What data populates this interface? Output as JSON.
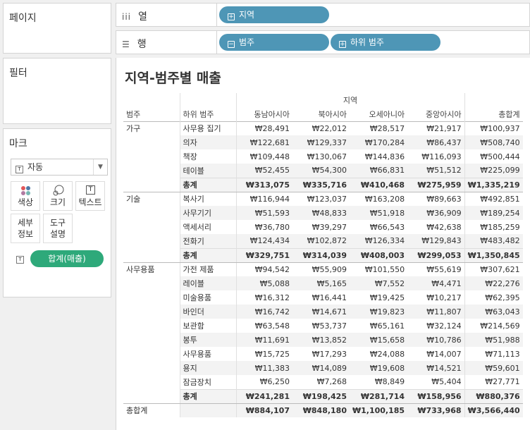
{
  "left": {
    "pages_title": "페이지",
    "filters_title": "필터",
    "marks_title": "마크",
    "mark_type": "자동",
    "mark_buttons": [
      "색상",
      "크기",
      "텍스트",
      "세부\n정보",
      "도구\n설명"
    ],
    "mark_pill": "합계(매출)"
  },
  "shelves": {
    "columns_label": "열",
    "rows_label": "행",
    "columns_pill": "지역",
    "rows_pills": [
      "범주",
      "하위 범주"
    ]
  },
  "view": {
    "title": "지역-범주별 매출",
    "header_group": "지역",
    "headers": [
      "범주",
      "하위 범주",
      "동남아시아",
      "북아시아",
      "오세아니아",
      "중앙아시아",
      "총합계"
    ],
    "groups": [
      {
        "category": "가구",
        "rows": [
          [
            "사무용 집기",
            "₩28,491",
            "₩22,012",
            "₩28,517",
            "₩21,917",
            "₩100,937"
          ],
          [
            "의자",
            "₩122,681",
            "₩129,337",
            "₩170,284",
            "₩86,437",
            "₩508,740"
          ],
          [
            "책장",
            "₩109,448",
            "₩130,067",
            "₩144,836",
            "₩116,093",
            "₩500,444"
          ],
          [
            "테이블",
            "₩52,455",
            "₩54,300",
            "₩66,831",
            "₩51,512",
            "₩225,099"
          ]
        ],
        "total": [
          "총계",
          "₩313,075",
          "₩335,716",
          "₩410,468",
          "₩275,959",
          "₩1,335,219"
        ]
      },
      {
        "category": "기술",
        "rows": [
          [
            "복사기",
            "₩116,944",
            "₩123,037",
            "₩163,208",
            "₩89,663",
            "₩492,851"
          ],
          [
            "사무기기",
            "₩51,593",
            "₩48,833",
            "₩51,918",
            "₩36,909",
            "₩189,254"
          ],
          [
            "액세서리",
            "₩36,780",
            "₩39,297",
            "₩66,543",
            "₩42,638",
            "₩185,259"
          ],
          [
            "전화기",
            "₩124,434",
            "₩102,872",
            "₩126,334",
            "₩129,843",
            "₩483,482"
          ]
        ],
        "total": [
          "총계",
          "₩329,751",
          "₩314,039",
          "₩408,003",
          "₩299,053",
          "₩1,350,845"
        ]
      },
      {
        "category": "사무용품",
        "rows": [
          [
            "가전 제품",
            "₩94,542",
            "₩55,909",
            "₩101,550",
            "₩55,619",
            "₩307,621"
          ],
          [
            "레이블",
            "₩5,088",
            "₩5,165",
            "₩7,552",
            "₩4,471",
            "₩22,276"
          ],
          [
            "미술용품",
            "₩16,312",
            "₩16,441",
            "₩19,425",
            "₩10,217",
            "₩62,395"
          ],
          [
            "바인더",
            "₩16,742",
            "₩14,671",
            "₩19,823",
            "₩11,807",
            "₩63,043"
          ],
          [
            "보관함",
            "₩63,548",
            "₩53,737",
            "₩65,161",
            "₩32,124",
            "₩214,569"
          ],
          [
            "봉투",
            "₩11,691",
            "₩13,852",
            "₩15,658",
            "₩10,786",
            "₩51,988"
          ],
          [
            "사무용품",
            "₩15,725",
            "₩17,293",
            "₩24,088",
            "₩14,007",
            "₩71,113"
          ],
          [
            "용지",
            "₩11,383",
            "₩14,089",
            "₩19,608",
            "₩14,521",
            "₩59,601"
          ],
          [
            "잠금장치",
            "₩6,250",
            "₩7,268",
            "₩8,849",
            "₩5,404",
            "₩27,771"
          ]
        ],
        "total": [
          "총계",
          "₩241,281",
          "₩198,425",
          "₩281,714",
          "₩158,956",
          "₩880,376"
        ]
      }
    ],
    "grand_total": [
      "총합계",
      "₩884,107",
      "₩848,180",
      "₩1,100,185",
      "₩733,968",
      "₩3,566,440"
    ]
  }
}
